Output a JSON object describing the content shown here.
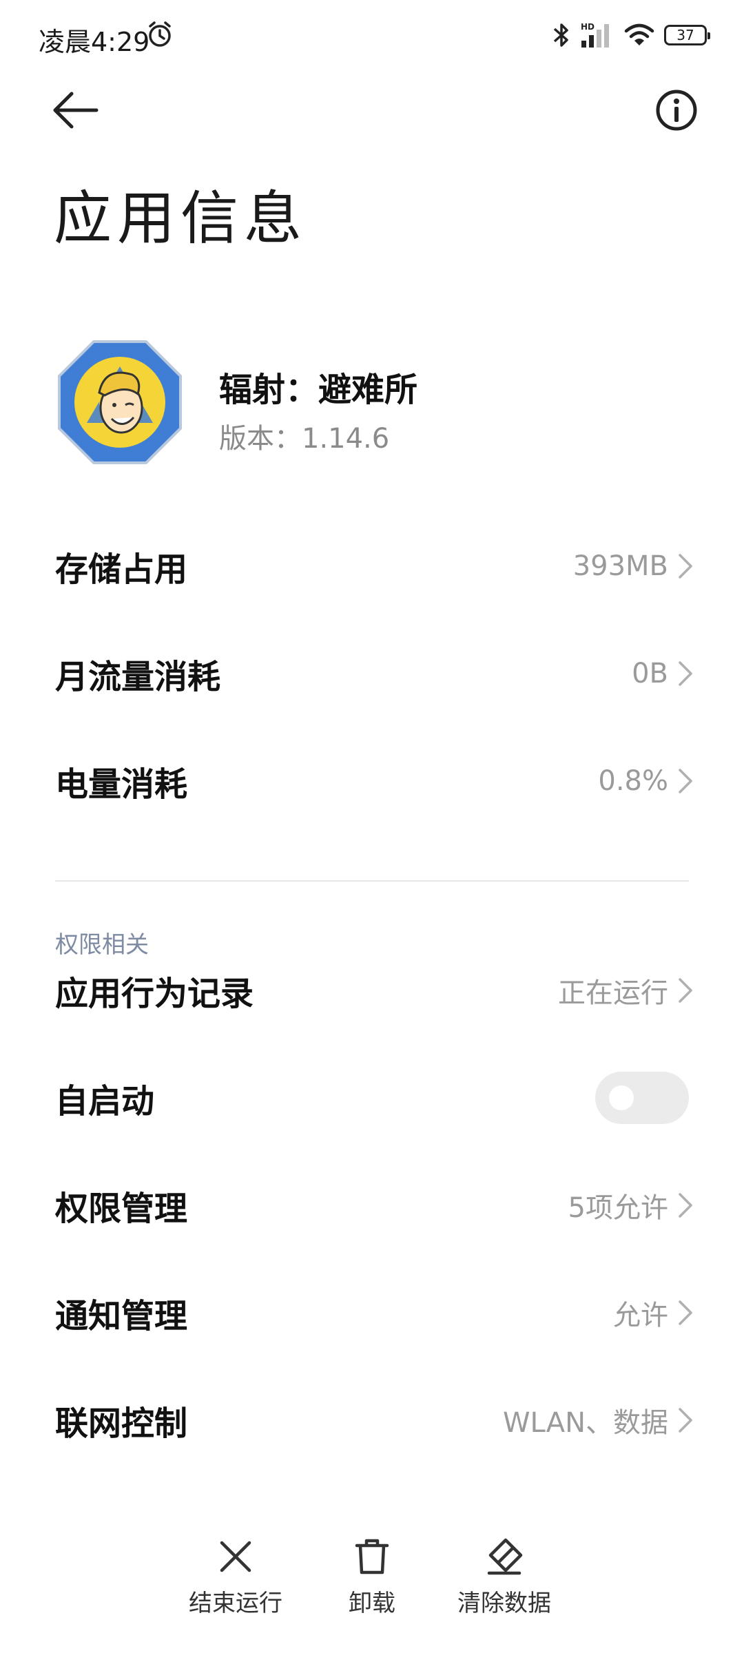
{
  "status_bar": {
    "time": "凌晨4:29",
    "hd_label": "HD",
    "battery": "37"
  },
  "header": {
    "title": "应用信息"
  },
  "app": {
    "name": "辐射：避难所",
    "version": "版本：1.14.6"
  },
  "usage_rows": [
    {
      "label": "存储占用",
      "value": "393MB"
    },
    {
      "label": "月流量消耗",
      "value": "0B"
    },
    {
      "label": "电量消耗",
      "value": "0.8%"
    }
  ],
  "permissions": {
    "section_title": "权限相关",
    "rows": [
      {
        "label": "应用行为记录",
        "value": "正在运行"
      },
      {
        "label": "自启动",
        "toggle": false
      },
      {
        "label": "权限管理",
        "value": "5项允许"
      },
      {
        "label": "通知管理",
        "value": "允许"
      },
      {
        "label": "联网控制",
        "value": "WLAN、数据"
      }
    ]
  },
  "actions": [
    {
      "label": "结束运行",
      "icon": "close-icon"
    },
    {
      "label": "卸载",
      "icon": "trash-icon"
    },
    {
      "label": "清除数据",
      "icon": "eraser-icon"
    }
  ],
  "colors": {
    "accent_muted": "#7e8ba3",
    "value_gray": "#9a9a9a",
    "toggle_off": "#ebebeb"
  }
}
